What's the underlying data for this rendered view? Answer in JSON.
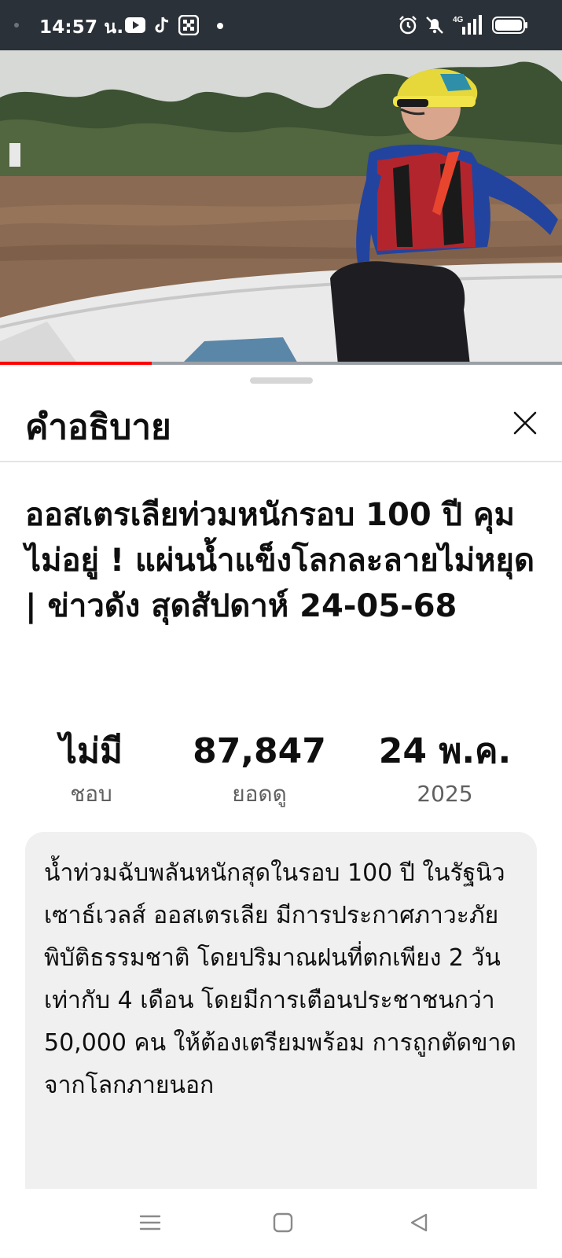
{
  "status_bar": {
    "time": "14:57 น.",
    "icons": [
      "youtube-icon",
      "tiktok-icon",
      "mosaic-app-icon",
      "more-notifications-dot",
      "alarm-icon",
      "mute-icon",
      "signal-4g-icon",
      "battery-icon"
    ],
    "network_label": "4G"
  },
  "video": {
    "progress": 0.27,
    "progress_color": "#ff0000"
  },
  "sheet": {
    "title": "คำอธิบาย",
    "close_icon": "close-icon"
  },
  "video_info": {
    "title": "ออสเตรเลียท่วมหนักรอบ 100 ปี คุมไม่อยู่ ! แผ่นน้ำแข็งโลกละลายไม่หยุด  | ข่าวดัง สุดสัปดาห์ 24-05-68",
    "likes_value": "ไม่มี",
    "likes_label": "ชอบ",
    "views_value": "87,847",
    "views_label": "ยอดดู",
    "date_value": "24 พ.ค.",
    "date_year": "2025",
    "description": "น้ำท่วมฉับพลันหนักสุดในรอบ 100 ปี ในรัฐนิวเซาธ์เวลส์ ออสเตรเลีย มีการประกาศภาวะภัยพิบัติธรรมชาติ โดยปริมาณฝนที่ตกเพียง 2 วัน เท่ากับ 4 เดือน โดยมีการเตือนประชาชนกว่า 50,000 คน ให้ต้องเตรียมพร้อม การถูกตัดขาดจากโลกภายนอก"
  },
  "nav_bar": {
    "icons": [
      "menu-icon",
      "home-icon",
      "back-icon"
    ]
  },
  "colors": {
    "status_bar_bg": "#2b3138",
    "desc_bg": "#f0f0f0",
    "secondary_text": "#606060"
  }
}
